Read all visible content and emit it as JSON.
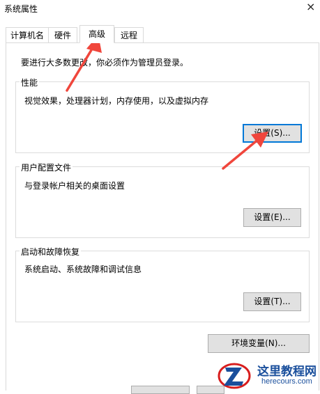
{
  "window": {
    "title": "系统属性",
    "close_glyph": "×"
  },
  "tabs": [
    {
      "label": "计算机名",
      "active": false
    },
    {
      "label": "硬件",
      "active": false
    },
    {
      "label": "高级",
      "active": true
    },
    {
      "label": "远程",
      "active": false
    }
  ],
  "advanced": {
    "admin_note": "要进行大多数更改，你必须作为管理员登录。",
    "performance": {
      "title": "性能",
      "description": "视觉效果，处理器计划，内存使用，以及虚拟内存",
      "button": "设置(S)..."
    },
    "user_profiles": {
      "title": "用户配置文件",
      "description": "与登录帐户相关的桌面设置",
      "button": "设置(E)..."
    },
    "startup_recovery": {
      "title": "启动和故障恢复",
      "description": "系统启动、系统故障和调试信息",
      "button": "设置(T)..."
    },
    "env_button": "环境变量(N)..."
  },
  "watermark": {
    "site_name": "这里教程网",
    "domain": "herecours.com",
    "color": "#1a4f9c"
  },
  "annotation_color": "#f0463c"
}
